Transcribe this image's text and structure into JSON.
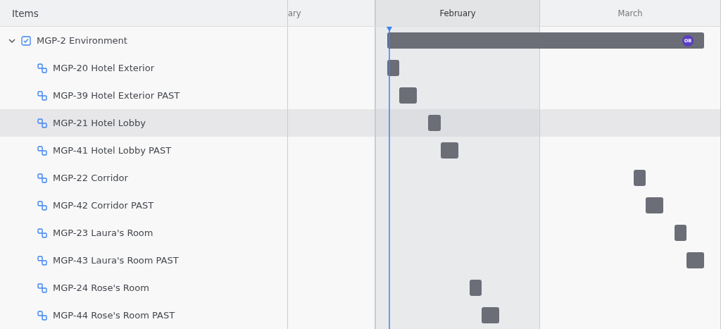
{
  "header": {
    "title": "Items"
  },
  "months": [
    {
      "label": "ary",
      "selected": false
    },
    {
      "label": "February",
      "selected": true
    },
    {
      "label": "March",
      "selected": false
    }
  ],
  "items": [
    {
      "kind": "epic",
      "label": "MGP-2 Environment",
      "expanded": true,
      "selected": false,
      "assignee": "OB",
      "children": [
        {
          "kind": "story",
          "label": "MGP-20 Hotel Exterior",
          "selected": false
        },
        {
          "kind": "story",
          "label": "MGP-39 Hotel Exterior PAST",
          "selected": false
        },
        {
          "kind": "story",
          "label": "MGP-21 Hotel Lobby",
          "selected": true
        },
        {
          "kind": "story",
          "label": "MGP-41 Hotel Lobby PAST",
          "selected": false
        },
        {
          "kind": "story",
          "label": "MGP-22 Corridor",
          "selected": false
        },
        {
          "kind": "story",
          "label": "MGP-42 Corridor PAST",
          "selected": false
        },
        {
          "kind": "story",
          "label": "MGP-23 Laura's Room",
          "selected": false
        },
        {
          "kind": "story",
          "label": "MGP-43 Laura's Room PAST",
          "selected": false
        },
        {
          "kind": "story",
          "label": "MGP-24 Rose's Room",
          "selected": false
        },
        {
          "kind": "story",
          "label": "MGP-44 Rose's Room PAST",
          "selected": false
        }
      ]
    }
  ]
}
